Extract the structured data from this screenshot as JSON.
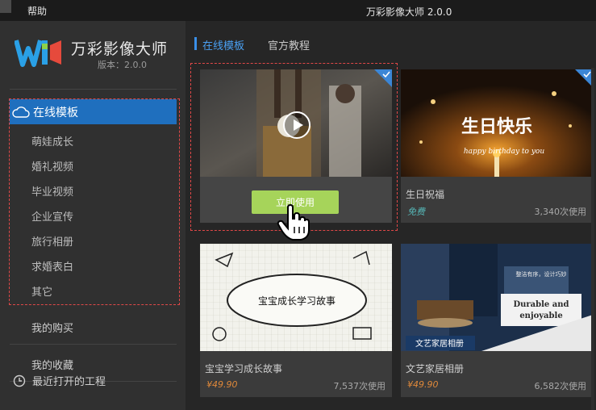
{
  "menu": {
    "help": "帮助"
  },
  "window": {
    "title": "万彩影像大师 2.0.0"
  },
  "app": {
    "name": "万彩影像大师",
    "version": "版本：2.0.0"
  },
  "sidebar": {
    "active": {
      "label": "在线模板",
      "icon": "cloud-icon"
    },
    "items": [
      {
        "label": "萌娃成长"
      },
      {
        "label": "婚礼视频"
      },
      {
        "label": "毕业视频"
      },
      {
        "label": "企业宣传"
      },
      {
        "label": "旅行相册"
      },
      {
        "label": "求婚表白"
      },
      {
        "label": "其它"
      }
    ],
    "my_purchases": "我的购买",
    "my_favorites": "我的收藏",
    "recent_projects": "最近打开的工程"
  },
  "tabs": {
    "active": "在线模板",
    "tutorials": "官方教程"
  },
  "templates": [
    {
      "name": "",
      "button": "立即使用",
      "state": "hover"
    },
    {
      "name": "生日祝福",
      "price": "免费",
      "uses": "3,340次使用",
      "thumb_title": "生日快乐",
      "thumb_subtitle": "happy birthday to you"
    },
    {
      "name": "宝宝学习成长故事",
      "price": "¥49.90",
      "uses": "7,537次使用",
      "thumb_title": "宝宝成长学习故事"
    },
    {
      "name": "文艺家居相册",
      "price": "¥49.90",
      "uses": "6,582次使用",
      "thumb_title": "文艺家居相册",
      "thumb_quote": "Durable and enjoyable",
      "thumb_tag": "整洁有序，设计巧妙"
    }
  ],
  "colors": {
    "accent": "#1f6fbe",
    "use_button": "#a6d45a",
    "price": "#e0893a",
    "free": "#56b7b7",
    "dashed": "#e04848"
  }
}
